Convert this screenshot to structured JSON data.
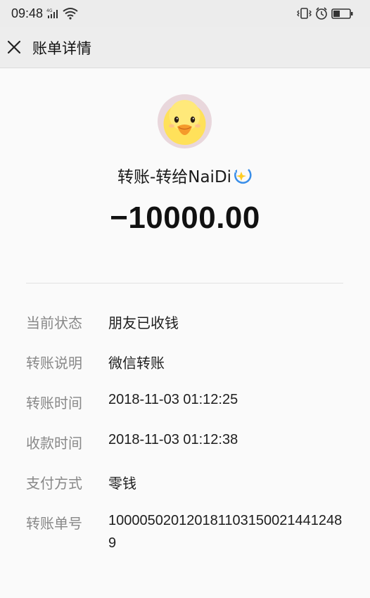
{
  "status_bar": {
    "time": "09:48",
    "signal_label": "4G",
    "icons": [
      "signal-icon",
      "wifi-icon",
      "vibrate-icon",
      "alarm-icon",
      "battery-icon"
    ]
  },
  "nav": {
    "title": "账单详情",
    "close_icon": "close-icon"
  },
  "bill": {
    "recipient": "转账-转给NaiDi",
    "amount": "−10000.00"
  },
  "details": [
    {
      "label": "当前状态",
      "value": "朋友已收钱"
    },
    {
      "label": "转账说明",
      "value": "微信转账"
    },
    {
      "label": "转账时间",
      "value": "2018-11-03 01:12:25"
    },
    {
      "label": "收款时间",
      "value": "2018-11-03 01:12:38"
    },
    {
      "label": "支付方式",
      "value": "零钱"
    },
    {
      "label": "转账单号",
      "value": "1000050201201811031500214412489"
    }
  ],
  "colors": {
    "background": "#fafafa",
    "label_gray": "#888888",
    "text": "#1a1a1a"
  }
}
